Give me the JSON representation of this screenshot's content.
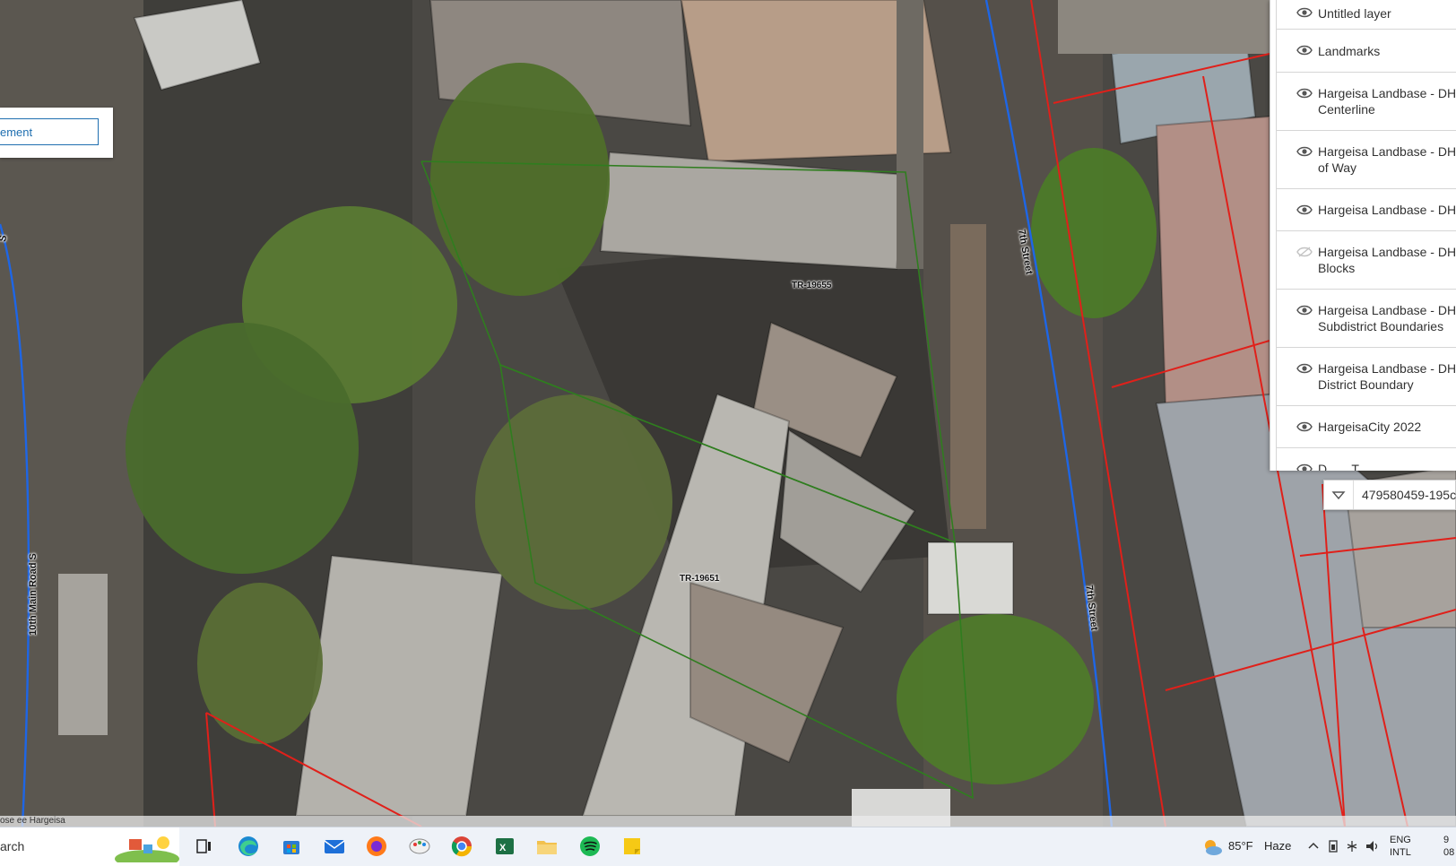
{
  "map": {
    "search_text": "ement",
    "parcel_labels": [
      "TR-19655",
      "TR-19651"
    ],
    "street_labels": {
      "seventh_upper": "7th Street",
      "seventh_lower": "7th Street",
      "tenth_main": "10th Main Road S",
      "edge_fragment": "S"
    },
    "attribution": "ose ee Hargeisa"
  },
  "layers": [
    {
      "label": "Untitled layer",
      "visible": true
    },
    {
      "label": "Landmarks",
      "visible": true
    },
    {
      "label": "Hargeisa Landbase - DH Centerline",
      "visible": true
    },
    {
      "label": "Hargeisa Landbase - DH of Way",
      "visible": true
    },
    {
      "label": "Hargeisa Landbase - DH",
      "visible": true
    },
    {
      "label": "Hargeisa Landbase - DH Blocks",
      "visible": false
    },
    {
      "label": "Hargeisa Landbase - DH Subdistrict Boundaries",
      "visible": true
    },
    {
      "label": "Hargeisa Landbase - DH District Boundary",
      "visible": true
    },
    {
      "label": "HargeisaCity 2022",
      "visible": true
    },
    {
      "label": "D... ...T...",
      "visible": true
    }
  ],
  "feature_select": {
    "value": "479580459-195c"
  },
  "taskbar": {
    "search_label": "arch",
    "weather": {
      "temp": "85°F",
      "condition": "Haze"
    },
    "lang_top": "ENG",
    "lang_bottom": "INTL",
    "clock_top": "9",
    "clock_bottom": "08"
  },
  "colors": {
    "parcel_outline": "#2f7d1f",
    "boundary_red": "#e0201a",
    "centerline_blue": "#1e66e6",
    "accent": "#1f6fb0",
    "taskbar_bg": "#eef2f8"
  },
  "icons": [
    "search-icon",
    "task-view-icon",
    "edge-icon",
    "store-icon",
    "mail-icon",
    "firefox-icon",
    "paint-icon",
    "chrome-icon",
    "excel-icon",
    "folder-icon",
    "spotify-icon",
    "sticky-notes-icon",
    "weather-icon",
    "chevron-up-icon",
    "network-icon",
    "volume-icon",
    "eye-icon",
    "chevron-down-icon"
  ]
}
